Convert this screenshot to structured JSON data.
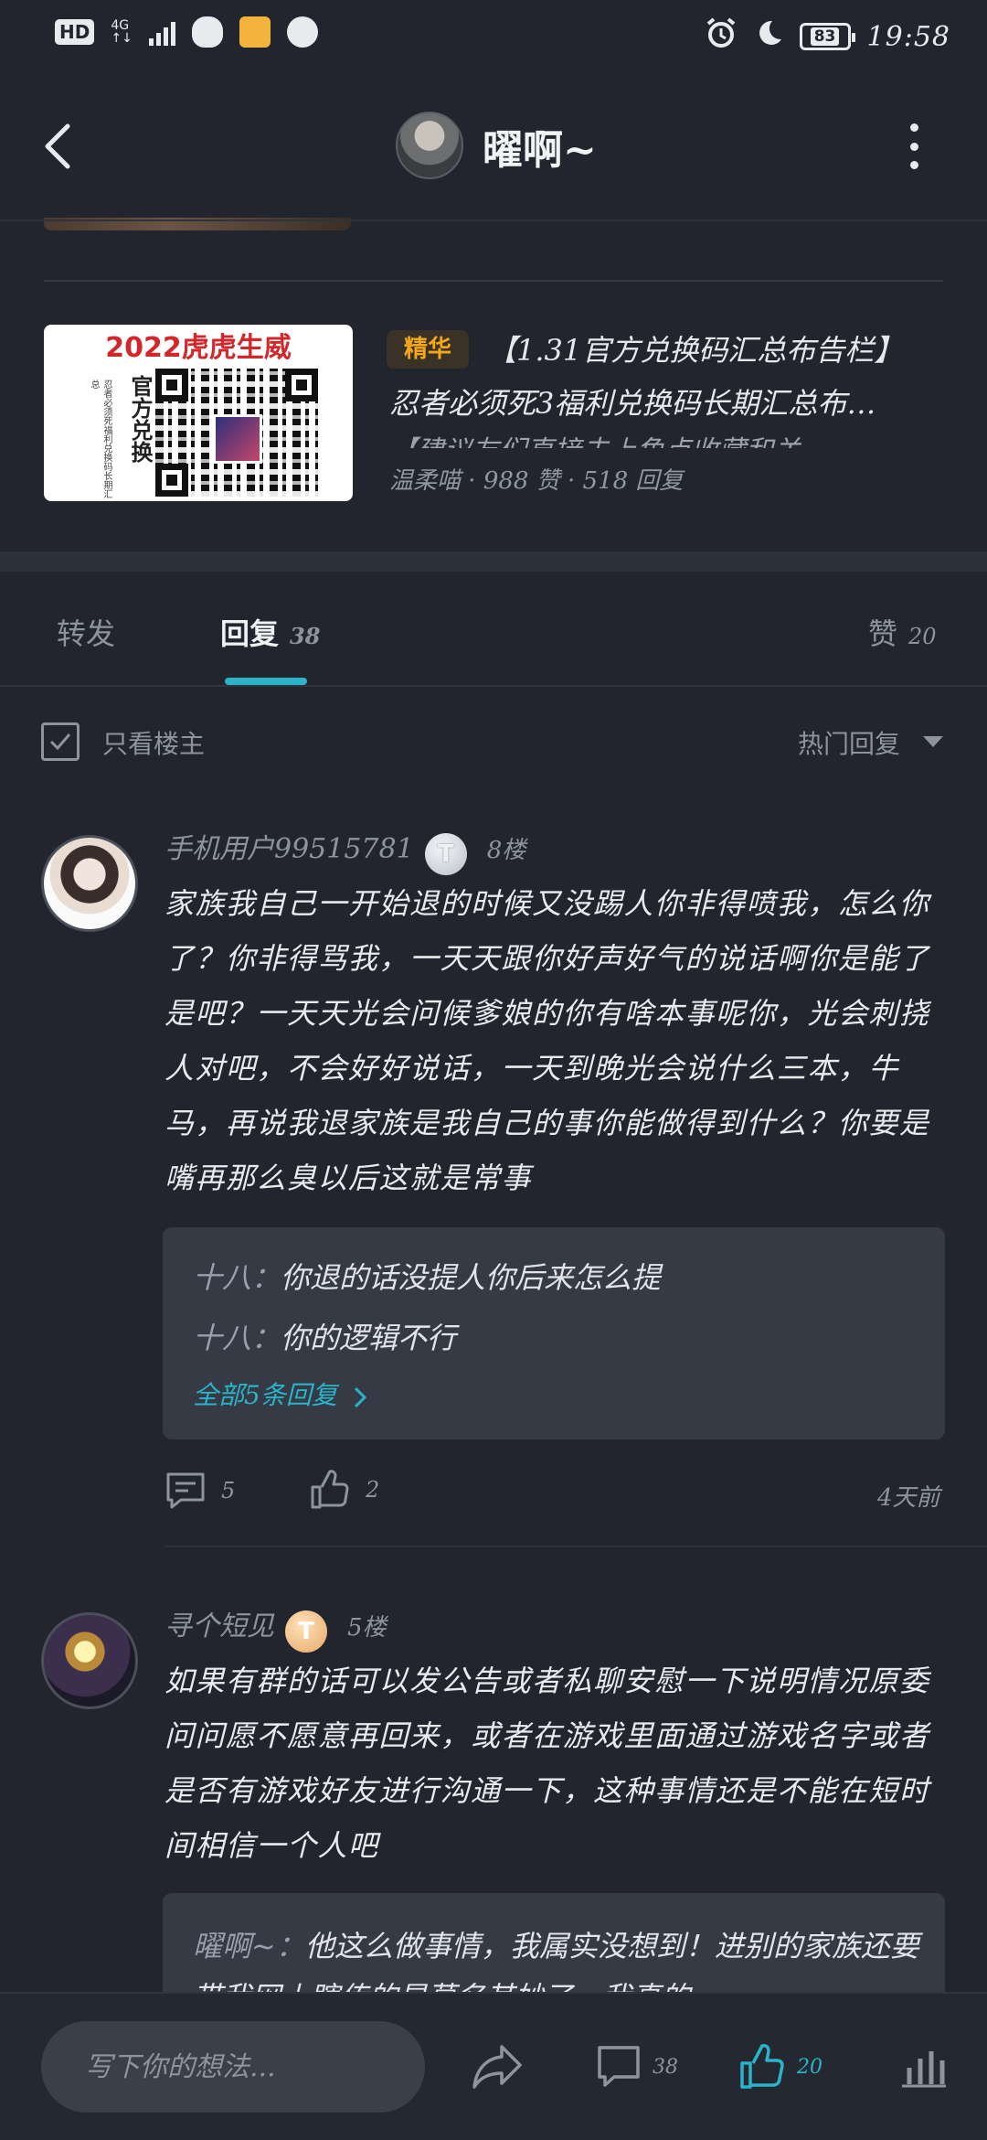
{
  "status_bar": {
    "network_badge": "HD",
    "network_type": "4G",
    "battery": "83",
    "time": "19:58"
  },
  "header": {
    "title": "曜啊~"
  },
  "featured_post": {
    "image_title": "2022虎虎生威",
    "image_vertical_text": "官方兑换",
    "image_small_text": "忍者必须死福利兑换码长期汇总",
    "badge": "精华",
    "title": "【1.31官方兑换码汇总布告栏】",
    "line2": "忍者必须死3福利兑换码长期汇总布…",
    "line3": "【建议友们直接去上角点收藏和关…",
    "author": "温柔喵",
    "likes": "988 赞",
    "replies": "518 回复"
  },
  "tabs": [
    {
      "label": "转发",
      "count": ""
    },
    {
      "label": "回复",
      "count": "38"
    },
    {
      "label": "赞",
      "count": "20"
    }
  ],
  "filter": {
    "only_op_label": "只看楼主",
    "sort_label": "热门回复"
  },
  "comments": [
    {
      "user": "手机用户99515781",
      "level": "T",
      "floor": "8楼",
      "body": "家族我自己一开始退的时候又没踢人你非得喷我，怎么你了？你非得骂我，一天天跟你好声好气的说话啊你是能了是吧？一天天光会问候爹娘的你有啥本事呢你，光会刺挠人对吧，不会好好说话，一天到晚光会说什么三本，牛马，再说我退家族是我自己的事你能做得到什么？你要是嘴再那么臭以后这就是常事",
      "replies": [
        {
          "name": "十八",
          "text": "你退的话没提人你后来怎么提"
        },
        {
          "name": "十八",
          "text": "你的逻辑不行"
        }
      ],
      "all_replies_label": "全部5条回复",
      "comment_count": "5",
      "like_count": "2",
      "time": "4天前"
    },
    {
      "user": "寻个短见",
      "level": "T",
      "floor": "5楼",
      "body": "如果有群的话可以发公告或者私聊安慰一下说明情况原委问问愿不愿意再回来，或者在游戏里面通过游戏名字或者是否有游戏好友进行沟通一下，这种事情还是不能在短时间相信一个人吧",
      "replies": [
        {
          "name": "曜啊~",
          "text": "他这么做事情，我属实没想到！进别的家族还要带我网上瞎传的是莫名其妙了，我真的"
        }
      ]
    }
  ],
  "bottom_bar": {
    "input_placeholder": "写下你的想法...",
    "comment_count": "38",
    "like_count": "20"
  },
  "colors": {
    "background": "#22252e",
    "accent": "#2ab3c9",
    "badge_text": "#f4a71a"
  }
}
